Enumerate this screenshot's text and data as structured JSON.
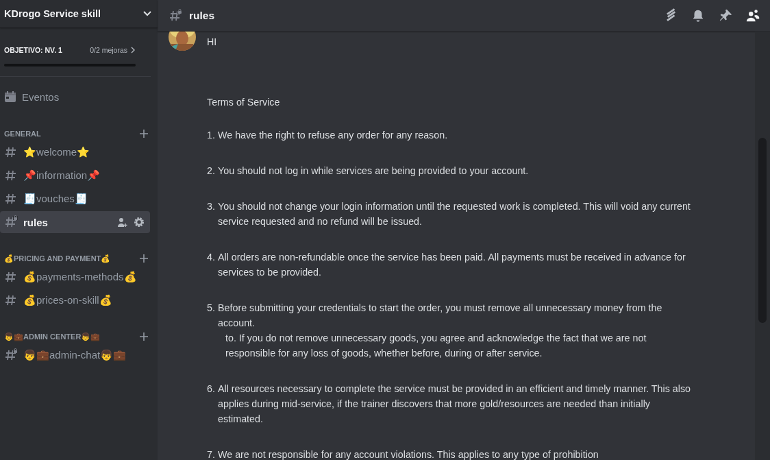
{
  "server": {
    "name": "KDrogo Service skill"
  },
  "boost": {
    "goal": "OBJETIVO: NV. 1",
    "progress": "0/2 mejoras",
    "level": 0
  },
  "events": {
    "label": "Eventos"
  },
  "categories": [
    {
      "name": "GENERAL",
      "channels": [
        {
          "name": "⭐welcome⭐",
          "locked": false,
          "selected": false
        },
        {
          "name": "📌information📌",
          "locked": false,
          "selected": false
        },
        {
          "name": "🧾vouches🧾",
          "locked": false,
          "selected": false
        },
        {
          "name": "rules",
          "locked": true,
          "selected": true
        }
      ]
    },
    {
      "name": "💰PRICING AND PAYMENT💰",
      "channels": [
        {
          "name": "💰payments-methods💰",
          "locked": false,
          "selected": false
        },
        {
          "name": "💰prices-on-skill💰",
          "locked": false,
          "selected": false
        }
      ]
    },
    {
      "name": "👦💼ADMIN CENTER👦💼",
      "channels": [
        {
          "name": "👦💼admin-chat👦💼",
          "locked": true,
          "selected": false
        }
      ]
    }
  ],
  "channel": {
    "name": "rules",
    "locked": true
  },
  "header_icons": [
    {
      "kind": "threads",
      "on": false
    },
    {
      "kind": "bell",
      "on": false
    },
    {
      "kind": "pin",
      "on": false
    },
    {
      "kind": "members",
      "on": true
    }
  ],
  "message": {
    "text": "HI",
    "title": "Terms of Service",
    "items": [
      {
        "number": "1.",
        "text": "We have the right to refuse any order for any reason."
      },
      {
        "number": "2.",
        "text": "You should not log in while services are being provided to your account."
      },
      {
        "number": "3.",
        "text": "You should not change your login information until the requested work is completed. This will void any current service requested and no refund will be issued."
      },
      {
        "number": "4.",
        "text": "All orders are non-refundable once the service has been paid. All payments must be received in advance for services to be provided."
      },
      {
        "number": "5.",
        "text": "Before submitting your credentials to start the order, you must remove all unnecessary money from the account.",
        "sub": "to. If you do not remove unnecessary goods, you agree and acknowledge the fact that we are not responsible for any loss of goods, whether before, during or after service."
      },
      {
        "number": "6.",
        "text": "All resources necessary to complete the service must be provided in an efficient and timely manner. This also applies during mid-service, if the trainer discovers that more gold/resources are needed than initially estimated."
      },
      {
        "number": "7.",
        "text": "We are not responsible for any account violations. This applies to any type of prohibition"
      }
    ]
  }
}
